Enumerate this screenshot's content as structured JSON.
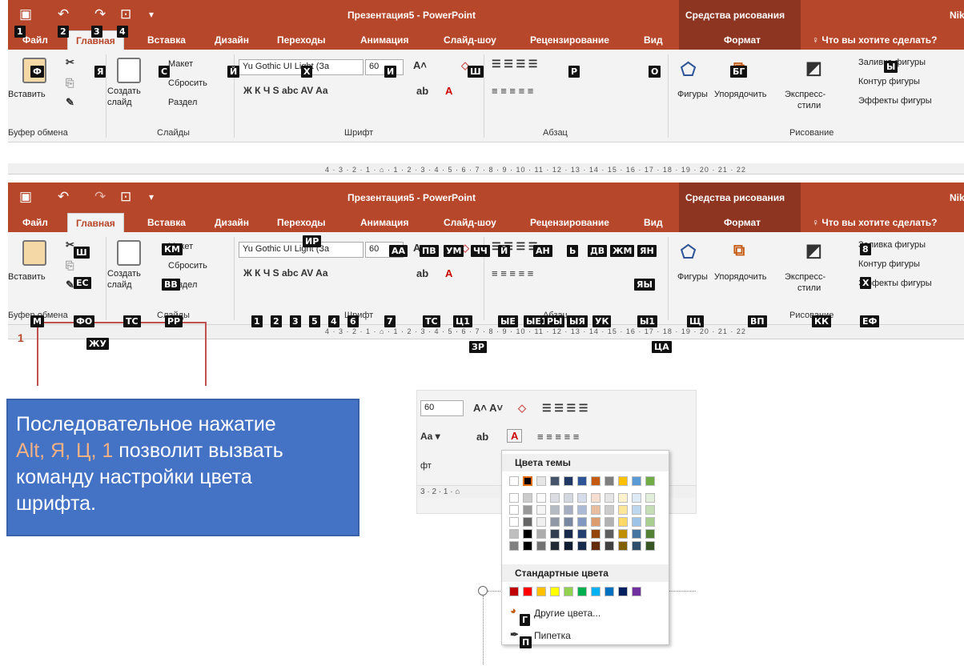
{
  "ribbon": {
    "title": "Презентация5 - PowerPoint",
    "context_title": "Средства рисования",
    "user": "Niko",
    "tabs": [
      "Файл",
      "Главная",
      "Вставка",
      "Дизайн",
      "Переходы",
      "Анимация",
      "Слайд-шоу",
      "Рецензирование",
      "Вид"
    ],
    "context_tab": "Формат",
    "tellme": "Что вы хотите сделать?",
    "groups": {
      "clipboard": "Буфер обмена",
      "slides": "Слайды",
      "font": "Шрифт",
      "paragraph": "Абзац",
      "drawing": "Рисование"
    },
    "buttons": {
      "paste": "Вставить",
      "new_slide_1": "Создать",
      "new_slide_2": "слайд",
      "layout": "Макет",
      "reset": "Сбросить",
      "section": "Раздел",
      "shapes": "Фигуры",
      "arrange": "Упорядочить",
      "quick_styles_1": "Экспресс-",
      "quick_styles_2": "стили",
      "fill": "Заливка фигуры",
      "outline": "Контур фигуры",
      "effects": "Эффекты фигуры"
    },
    "font_name": "Yu Gothic UI Light (За",
    "font_size": "60",
    "font_symbols": "Ж  К  Ч  S  abc  AV  Aa",
    "ruler": "4 · 3 · 2 · 1 · ⌂ · 1 · 2 · 3 · 4 · 5 · 6 · 7 · 8 · 9 · 10 · 11 · 12 · 13 · 14 · 15 · 16 · 17 · 18 · 19 · 20 · 21 · 22"
  },
  "keytips_top": {
    "qat": [
      "1",
      "2",
      "3",
      "4"
    ],
    "tabs": [
      "Ф",
      "Я",
      "С",
      "Й",
      "Х",
      "И",
      "Ш",
      "Р",
      "О",
      "БГ",
      "Ы"
    ]
  },
  "keytips_bottom": {
    "clipboard": [
      "Ш",
      "ЕС",
      "М",
      "ФО",
      "ЖУ"
    ],
    "slides": [
      "КМ",
      "ВВ",
      "ТС",
      "РР"
    ],
    "font": [
      "ИР",
      "АА",
      "ПВ",
      "УМ",
      "ЧЧ",
      "Й",
      "1",
      "2",
      "3",
      "5",
      "4",
      "6",
      "7",
      "ТС",
      "Ц1"
    ],
    "paragraph": [
      "АН",
      "Ь",
      "ДВ",
      "ЖМ",
      "ЯН",
      "ЯЫ",
      "ЫЕ",
      "Ы1",
      "ЫЕ1",
      "РЫ",
      "ЫЯ",
      "УК",
      "ЗР",
      "ЦА"
    ],
    "drawing": [
      "Щ",
      "ВП",
      "КК",
      "8",
      "Х",
      "ЕФ"
    ]
  },
  "thumbnail_number": "1",
  "info": {
    "line1": "Последовательное нажатие",
    "keys": "Alt, Я, Ц, 1",
    "line2_rest": " позволит вызвать",
    "line3": "команду настройки цвета",
    "line4": "шрифта."
  },
  "crop": {
    "font_size": "60",
    "font_abbrev": "фт",
    "ruler": "3 · 2 · 1 · ⌂"
  },
  "color_menu": {
    "theme_header": "Цвета темы",
    "standard_header": "Стандартные цвета",
    "more_colors": "Другие цвета...",
    "eyedropper": "Пипетка",
    "keytip_more": "Г",
    "keytip_eyedropper": "П",
    "theme_colors": [
      "#ffffff",
      "#000000",
      "#e7e6e6",
      "#44546a",
      "#1f3864",
      "#2e5597",
      "#c55a11",
      "#7f7f7f",
      "#ffc000",
      "#5b9bd5",
      "#70ad47"
    ],
    "standard_colors": [
      "#c00000",
      "#ff0000",
      "#ffc000",
      "#ffff00",
      "#92d050",
      "#00b050",
      "#00b0f0",
      "#0070c0",
      "#002060",
      "#7030a0"
    ]
  }
}
